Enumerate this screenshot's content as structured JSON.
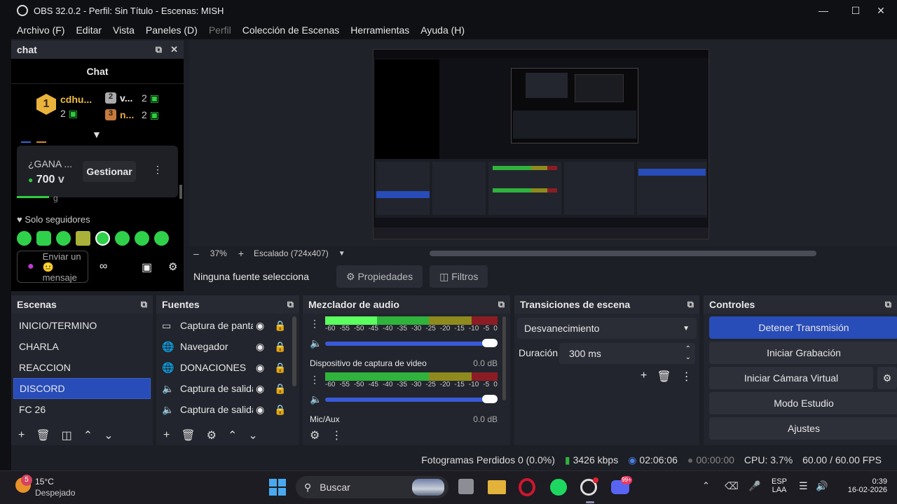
{
  "window": {
    "title": "OBS 32.0.2 - Perfil: Sin Título - Escenas: MISH"
  },
  "menu": [
    "Archivo (F)",
    "Editar",
    "Vista",
    "Paneles (D)",
    "Perfil",
    "Colección de Escenas",
    "Herramientas",
    "Ayuda (H)"
  ],
  "chat": {
    "dock_title": "chat",
    "header": "Chat",
    "leader1": {
      "rank": "1",
      "name": "cdhu...",
      "count": "2"
    },
    "leader2": {
      "rank": "2",
      "name": "v...",
      "count": "2"
    },
    "leader3": {
      "rank": "3",
      "name": "n...",
      "count": "2"
    },
    "prediction_question": "¿GANA ...",
    "prediction_points": "700",
    "prediction_suffix": "v",
    "manage_label": "Gestionar",
    "followers_only": "Solo seguidores",
    "send_placeholder": "Enviar un 😐 mensaje",
    "partial_text": "g"
  },
  "preview": {
    "zoom": "37%",
    "scaling": "Escalado (724x407)"
  },
  "source_bar": {
    "no_source": "Ninguna fuente selecciona",
    "properties": "Propiedades",
    "filters": "Filtros"
  },
  "scenes": {
    "title": "Escenas",
    "items": [
      "INICIO/TERMINO",
      "CHARLA",
      "REACCION",
      "DISCORD",
      "FC 26"
    ],
    "selected": "DISCORD"
  },
  "sources": {
    "title": "Fuentes",
    "items": [
      {
        "name": "Captura de pantalla",
        "icon": "monitor-icon"
      },
      {
        "name": "Navegador",
        "icon": "globe-icon"
      },
      {
        "name": "DONACIONES",
        "icon": "globe-icon"
      },
      {
        "name": "Captura de salida de audio",
        "icon": "speaker-icon"
      },
      {
        "name": "Captura de salida de audio",
        "icon": "speaker-icon"
      }
    ]
  },
  "mixer": {
    "title": "Mezclador de audio",
    "ticks": [
      "-60",
      "-55",
      "-50",
      "-45",
      "-40",
      "-35",
      "-30",
      "-25",
      "-20",
      "-15",
      "-10",
      "-5",
      "0"
    ],
    "channel2_name": "Dispositivo de captura de video",
    "channel2_db": "0.0 dB",
    "channel3_name": "Mic/Aux",
    "channel3_db": "0.0 dB",
    "channel1_level": 0.3,
    "channel2_level": 0.0
  },
  "transitions": {
    "title": "Transiciones de escena",
    "selected": "Desvanecimiento",
    "duration_label": "Duración",
    "duration_value": "300 ms"
  },
  "controls": {
    "title": "Controles",
    "buttons": [
      "Detener Transmisión",
      "Iniciar Grabación",
      "Iniciar Cámara Virtual",
      "Modo Estudio",
      "Ajustes"
    ]
  },
  "status": {
    "dropped": "Fotogramas Perdidos 0 (0.0%)",
    "bitrate": "3426 kbps",
    "stream_time": "02:06:06",
    "rec_time": "00:00:00",
    "cpu": "CPU: 3.7%",
    "fps": "60.00 / 60.00 FPS"
  },
  "taskbar": {
    "weather_temp": "15°C",
    "weather_desc": "Despejado",
    "weather_badge": "5",
    "search": "Buscar",
    "lang1": "ESP",
    "lang2": "LAA",
    "time": "0:39",
    "date": "16-02-2026",
    "discord_badge": "99+"
  },
  "colors": {
    "accent": "#284cb8",
    "meter_green": "#2fb33c",
    "meter_yellow": "#8f8a1d",
    "meter_red": "#8c1c24"
  }
}
